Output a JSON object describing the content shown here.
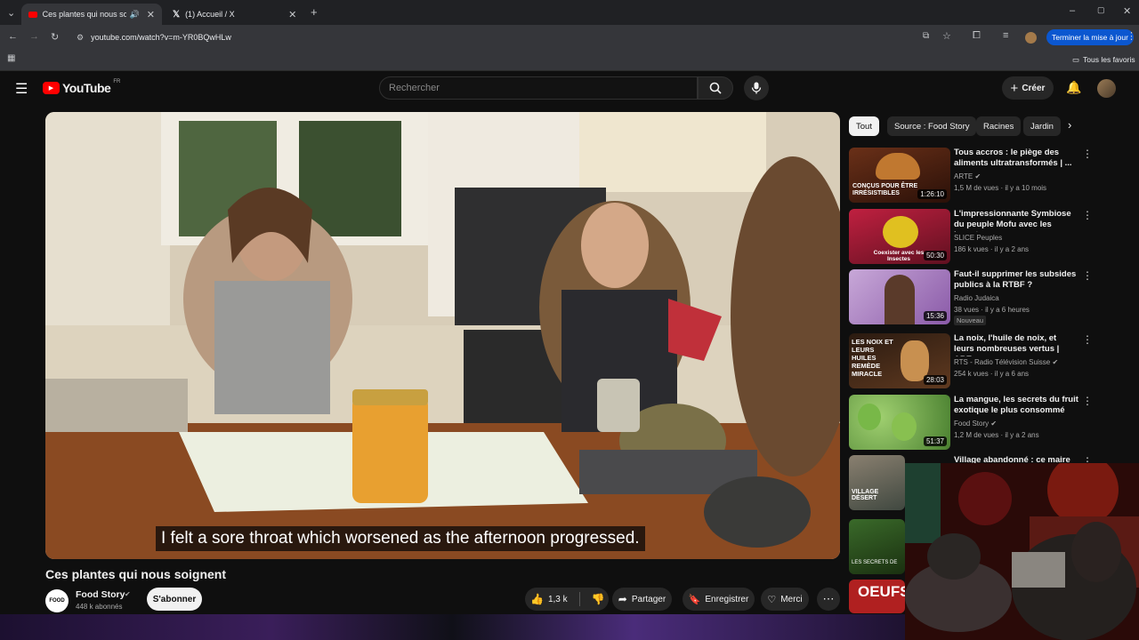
{
  "browser": {
    "tabs": [
      {
        "title": "Ces plantes qui nous soignent",
        "active": true
      },
      {
        "title": "(1) Accueil / X",
        "active": false
      }
    ],
    "url": "youtube.com/watch?v=m-YR0BQwHLw",
    "update_button": "Terminer la mise à jour",
    "all_bookmarks": "Tous les favoris"
  },
  "yt": {
    "logo_text": "YouTube",
    "logo_country": "FR",
    "search_placeholder": "Rechercher",
    "create_label": "Créer"
  },
  "video": {
    "subtitle": "I felt a sore throat which worsened as the afternoon progressed.",
    "title": "Ces plantes qui nous soignent",
    "channel": "Food Story",
    "subscribers": "448 k abonnés",
    "subscribe_label": "S'abonner",
    "likes": "1,3 k",
    "share_label": "Partager",
    "save_label": "Enregistrer",
    "thanks_label": "Merci"
  },
  "chips": [
    "Tout",
    "Source : Food Story",
    "Racines",
    "Jardin"
  ],
  "recommendations": [
    {
      "title": "Tous accros : le piège des aliments ultratransformés | ...",
      "channel": "ARTE",
      "verified": true,
      "meta": "1,5 M de vues · il y a 10 mois",
      "duration": "1:26:10",
      "thumb_text": "CONÇUS POUR ÊTRE IRRÉSISTIBLES",
      "badge": ""
    },
    {
      "title": "L'impressionnante Symbiose du peuple Mofu avec les Insectes...",
      "channel": "SLICE Peuples",
      "verified": false,
      "meta": "186 k vues · il y a 2 ans",
      "duration": "50:30",
      "thumb_text": "Coexister avec les Insectes",
      "badge": ""
    },
    {
      "title": "Faut-il supprimer les subsides publics à la RTBF ?",
      "channel": "Radio Judaica",
      "verified": false,
      "meta": "38 vues · il y a 6 heures",
      "duration": "15:36",
      "thumb_text": "",
      "badge": "Nouveau"
    },
    {
      "title": "La noix, l'huile de noix, et leurs nombreuses vertus | ABE",
      "channel": "RTS - Radio Télévision Suisse",
      "verified": true,
      "meta": "254 k vues · il y a 6 ans",
      "duration": "28:03",
      "thumb_text": "LES NOIX ET LEURS HUILES REMÈDE MIRACLE",
      "badge": ""
    },
    {
      "title": "La mangue, les secrets du fruit exotique le plus consommé au...",
      "channel": "Food Story",
      "verified": true,
      "meta": "1,2 M de vues · il y a 2 ans",
      "duration": "51:37",
      "thumb_text": "",
      "badge": ""
    },
    {
      "title": "Village abandonné : ce maire se",
      "channel": "",
      "verified": false,
      "meta": "",
      "duration": "",
      "thumb_text": "VILLAGE DÉSERT",
      "badge": ""
    }
  ],
  "partial_thumbs": [
    "LES SECRETS DE",
    "OEUFS"
  ],
  "colors": {
    "yt_red": "#ff0000",
    "bg": "#0f0f0f",
    "chip": "#272727",
    "update_btn": "#8ab4f8"
  }
}
